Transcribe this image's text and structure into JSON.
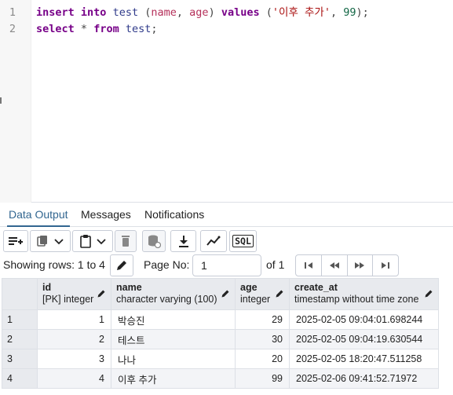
{
  "editor": {
    "line_numbers": [
      "1",
      "2"
    ],
    "line1": {
      "kw_insert": "insert",
      "kw_into": "into",
      "table": "test",
      "paren_open": "(",
      "col1": "name",
      "comma1": ",",
      "col2": "age",
      "paren_close": ")",
      "kw_values": "values",
      "val_open": "(",
      "str_value": "'이후 추가'",
      "comma2": ",",
      "num_value": "99",
      "end": ");"
    },
    "line2": {
      "kw_select": "select",
      "star": "*",
      "kw_from": "from",
      "table": "test",
      "end": ";"
    }
  },
  "tabs": [
    {
      "label": "Data Output",
      "active": true
    },
    {
      "label": "Messages",
      "active": false
    },
    {
      "label": "Notifications",
      "active": false
    }
  ],
  "toolbar": {
    "buttons": [
      "add-row-icon",
      "copy-icon",
      "chevron-down-icon",
      "paste-icon",
      "chevron-down-icon",
      "delete-icon",
      "save-data-icon",
      "download-icon",
      "graph-icon",
      "sql-icon"
    ],
    "sql_label": "SQL"
  },
  "pager": {
    "showing_label": "Showing rows: 1 to 4",
    "page_no_label": "Page No:",
    "page_value": "1",
    "of_label": "of 1"
  },
  "grid": {
    "columns": [
      {
        "name": "id",
        "type": "[PK] integer"
      },
      {
        "name": "name",
        "type": "character varying (100)"
      },
      {
        "name": "age",
        "type": "integer"
      },
      {
        "name": "create_at",
        "type": "timestamp without time zone"
      }
    ],
    "rows": [
      {
        "n": "1",
        "id": "1",
        "name": "박승진",
        "age": "29",
        "create_at": "2025-02-05 09:04:01.698244"
      },
      {
        "n": "2",
        "id": "2",
        "name": "테스트",
        "age": "30",
        "create_at": "2025-02-05 09:04:19.630544"
      },
      {
        "n": "3",
        "id": "3",
        "name": "나나",
        "age": "20",
        "create_at": "2025-02-05 18:20:47.511258"
      },
      {
        "n": "4",
        "id": "4",
        "name": "이후 추가",
        "age": "99",
        "create_at": "2025-02-06 09:41:52.71972"
      }
    ]
  },
  "colors": {
    "accent": "#326690",
    "keyword": "#770088",
    "string": "#aa1111",
    "number": "#116644"
  }
}
